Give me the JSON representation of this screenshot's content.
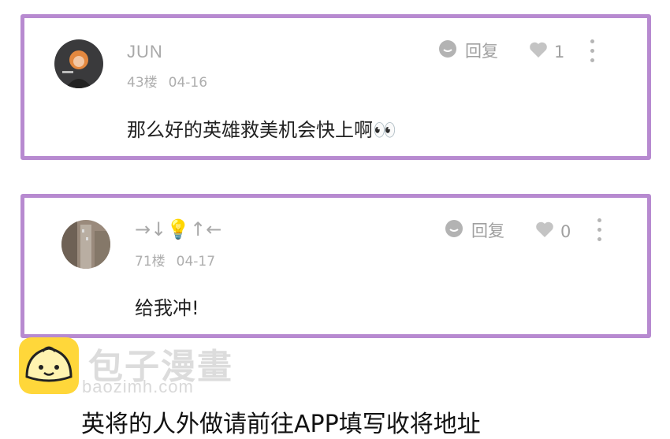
{
  "comments": [
    {
      "username": "JUN",
      "floor": "43楼",
      "date": "04-16",
      "text": "那么好的英雄救美机会快上啊👀",
      "reply_label": "回复",
      "like_count": "1"
    },
    {
      "username": "→↓💡↑←",
      "floor": "71楼",
      "date": "04-17",
      "text": "给我冲!",
      "reply_label": "回复",
      "like_count": "0"
    }
  ],
  "watermark": {
    "name": "包子漫畫",
    "url": "baozimh.com"
  },
  "footer_partial_text": "英将的人外做请前往APP填写收将地址",
  "colors": {
    "card_border": "#b78ad0",
    "muted_text": "#a9a9a9",
    "logo_yellow": "#ffd73a"
  }
}
